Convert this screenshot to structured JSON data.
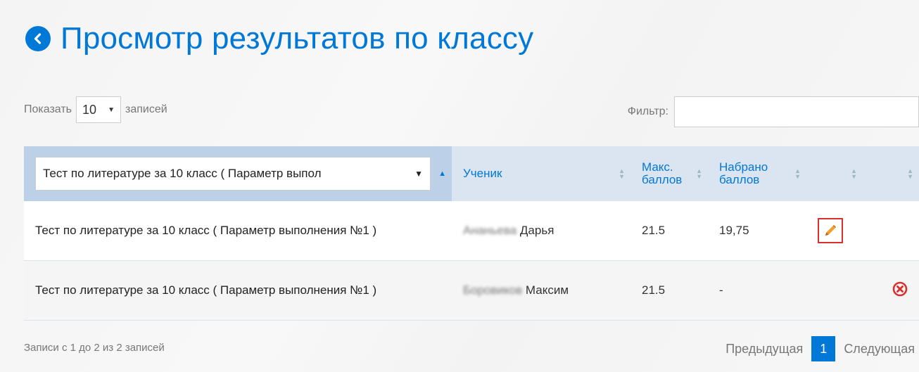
{
  "page_title": "Просмотр результатов по классу",
  "controls": {
    "show_label": "Показать",
    "show_value": "10",
    "records_label": "записей",
    "filter_label": "Фильтр:",
    "filter_value": ""
  },
  "table": {
    "headers": {
      "test_select": "Тест по литературе за 10 класс ( Параметр выпол",
      "student": "Ученик",
      "max_points_1": "Макс.",
      "max_points_2": "баллов",
      "scored_1": "Набрано",
      "scored_2": "баллов"
    },
    "rows": [
      {
        "test": "Тест по литературе за 10 класс ( Параметр выполнения №1 )",
        "surname_blurred": "Ананьева",
        "name": "Дарья",
        "max": "21.5",
        "scored": "19,75",
        "action": "edit"
      },
      {
        "test": "Тест по литературе за 10 класс ( Параметр выполнения №1 )",
        "surname_blurred": "Боровиков",
        "name": "Максим",
        "max": "21.5",
        "scored": "-",
        "action": "delete"
      }
    ]
  },
  "footer": {
    "info": "Записи с 1 до 2 из 2 записей",
    "prev": "Предыдущая",
    "page": "1",
    "next": "Следующая"
  },
  "colors": {
    "accent": "#0078d7",
    "edit_border": "#d9302c",
    "delete": "#d9302c"
  }
}
